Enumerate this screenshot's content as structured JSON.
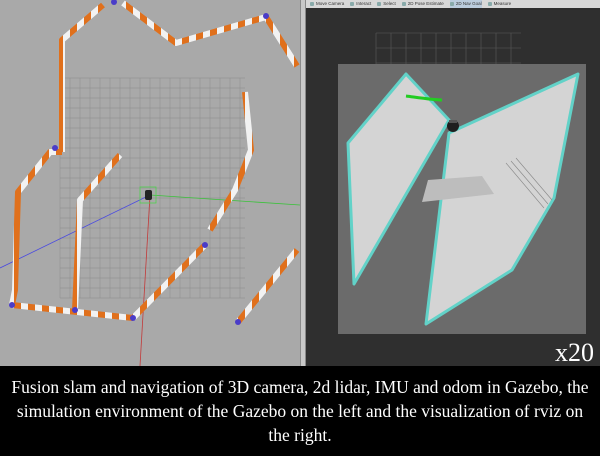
{
  "rviz": {
    "toolbar": [
      {
        "label": "Move Camera",
        "icon": "camera-icon"
      },
      {
        "label": "Interact",
        "icon": "interact-icon"
      },
      {
        "label": "Select",
        "icon": "select-icon"
      },
      {
        "label": "2D Pose Estimate",
        "icon": "pose-estimate-icon"
      },
      {
        "label": "2D Nav Goal",
        "icon": "nav-goal-icon"
      },
      {
        "label": "Measure",
        "icon": "measure-icon"
      }
    ],
    "speed_label": "x20"
  },
  "caption": {
    "text": "Fusion slam and navigation of 3D camera, 2d lidar, IMU and odom in Gazebo, the simulation environment of the Gazebo on the left and the visualization of rviz on the right."
  },
  "colors": {
    "gazebo_bg": "#a9a9a9",
    "barrier_orange": "#e0701c",
    "barrier_white": "#f2f2f2",
    "post_blue": "#4a3cc8",
    "rviz_bg": "#2f2f2f",
    "map_free": "#d4d4d4",
    "map_unknown": "#6b6b6b",
    "map_inflation": "#62d2c8",
    "path_green": "#22cc22"
  }
}
